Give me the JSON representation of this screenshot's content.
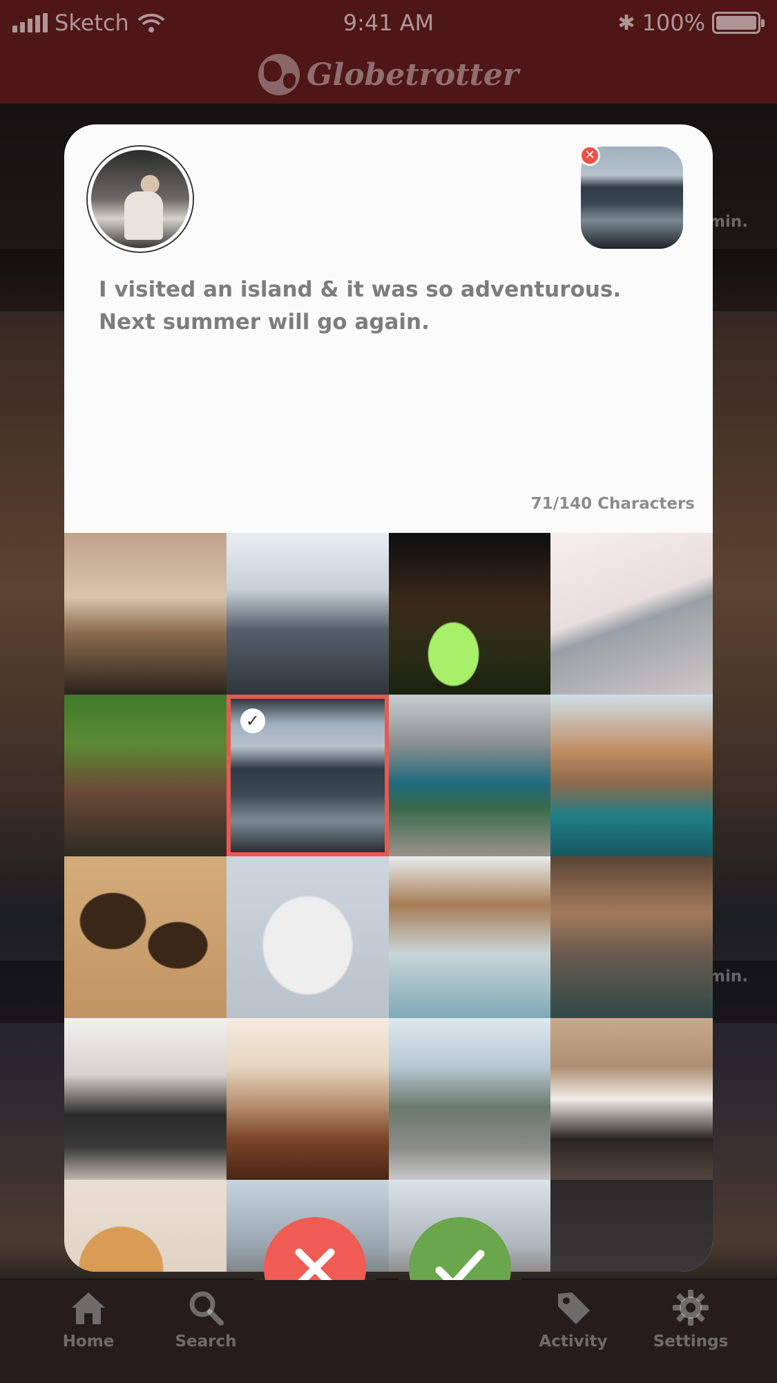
{
  "status_bar": {
    "carrier": "Sketch",
    "time": "9:41 AM",
    "battery": "100%"
  },
  "app": {
    "name": "Globetrotter"
  },
  "background_feed": {
    "time_labels": [
      "min.",
      "min."
    ]
  },
  "composer": {
    "text": "I visited an island & it was so adventurous. Next summer will go again.",
    "char_count": "71/140 Characters",
    "remove_icon": "close-icon"
  },
  "photos": [
    {
      "name": "photo-binoculars",
      "bg": "linear-gradient(180deg,#bfa48a 0%,#d9c3ab 40%,#8a6a4e 62%,#2c241f 100%)",
      "selected": false
    },
    {
      "name": "photo-airport",
      "bg": "linear-gradient(180deg,#e9eef2 0%,#c7d0d8 35%,#55606a 60%,#2e353c 100%)",
      "selected": false
    },
    {
      "name": "photo-tent",
      "bg": "radial-gradient(ellipse at 40% 75%,#a9f06a 0 18%,transparent 19%),linear-gradient(180deg,#0d0e10 0%,#3b2a1a 45%,#2a2c16 75%,#1a2210 100%)",
      "selected": false
    },
    {
      "name": "photo-wing",
      "bg": "linear-gradient(160deg,#f7eeee 0%,#e8dede 45%,#9aa0a6 55%,#cfc8c8 100%)",
      "selected": false
    },
    {
      "name": "photo-horse-rider",
      "bg": "linear-gradient(180deg,#3f7a2c 0%,#5b8a32 30%,#6a4a38 60%,#2d2a20 100%)",
      "selected": false
    },
    {
      "name": "photo-ferry-window",
      "bg": "linear-gradient(180deg,#1f262b 0%,#9fb0bf 18%,#b8c3cc 32%,#2f3a44 46%,#3b4955 62%,#7c8a95 78%,#1e2226 100%)",
      "selected": true
    },
    {
      "name": "photo-mountain-lake",
      "bg": "linear-gradient(180deg,#c7ced2 0%,#8d8f8f 30%,#1e6a7d 55%,#3a6b4c 70%,#9a928a 100%)",
      "selected": false
    },
    {
      "name": "photo-coastal-village",
      "bg": "linear-gradient(180deg,#cfe0e8 0%,#c08c62 35%,#8d6a4d 55%,#1f7f86 75%,#16585f 100%)",
      "selected": false
    },
    {
      "name": "photo-wooden-world-map",
      "bg": "radial-gradient(ellipse at 30% 40%,#3a2718 0 20%,transparent 21%),radial-gradient(ellipse at 70% 55%,#3a2718 0 18%,transparent 19%),linear-gradient(180deg,#d3ac7a 0%,#c29563 100%)",
      "selected": false
    },
    {
      "name": "photo-buddha-statue",
      "bg": "radial-gradient(ellipse at 50% 55%,#eeeeee 0 38%,transparent 40%),linear-gradient(180deg,#cdd6df 0%,#b9c2cb 100%)",
      "selected": false
    },
    {
      "name": "photo-surfer-pier",
      "bg": "linear-gradient(180deg,#e9edef 0%,#a67d55 30%,#c9d5d8 60%,#7fa9b6 100%)",
      "selected": false
    },
    {
      "name": "photo-cave-pool",
      "bg": "linear-gradient(180deg,#5b4536 0%,#a37a5c 35%,#6b5a4f 60%,#2f4a48 100%)",
      "selected": false
    },
    {
      "name": "photo-airport-seats",
      "bg": "linear-gradient(180deg,#f1f1f1 0%,#d5d3d0 35%,#2a2a2a 60%,#3b3b3b 80%,#bdb4a9 100%)",
      "selected": false
    },
    {
      "name": "photo-deck-sunset",
      "bg": "linear-gradient(180deg,#f4ebe0 0%,#e8d6c0 30%,#b48b6b 55%,#7a4428 75%,#4a2616 100%)",
      "selected": false
    },
    {
      "name": "photo-city-aerial",
      "bg": "linear-gradient(180deg,#dfe8ee 0%,#b7c8d3 30%,#6b7b6d 55%,#8a8a88 80%,#c9c9c9 100%)",
      "selected": false
    },
    {
      "name": "photo-woman-travel",
      "bg": "linear-gradient(180deg,#c9a98a 0%,#ad8f74 30%,#f0ece6 50%,#2a2420 75%,#534540 100%)",
      "selected": false
    },
    {
      "name": "photo-globe",
      "bg": "radial-gradient(circle at 35% 55%,#d89c55 0 30%,transparent 31%),linear-gradient(180deg,#eadfd3 0%,#d9cabb 100%)",
      "selected": false
    },
    {
      "name": "photo-mountains",
      "bg": "linear-gradient(180deg,#c8d4dd 0%,#9aa7b0 40%,#6b6e6a 70%,#3d3e3c 100%)",
      "selected": false
    },
    {
      "name": "photo-city-street",
      "bg": "linear-gradient(180deg,#d9e3e8 0%,#b0b8be 40%,#6d5f58 75%,#3d3532 100%)",
      "selected": false
    },
    {
      "name": "photo-hooded-traveler",
      "bg": "radial-gradient(ellipse at 55% 85%,#b8c8d8 0 22%,transparent 23%),linear-gradient(180deg,#2a2828 0%,#3a3838 60%,#1a1818 100%)",
      "selected": false
    }
  ],
  "actions": {
    "cancel_icon": "close-icon",
    "confirm_icon": "checkmark-icon"
  },
  "tabs": [
    {
      "label": "Home",
      "icon": "home-icon"
    },
    {
      "label": "Search",
      "icon": "search-icon"
    },
    {
      "label": "Activity",
      "icon": "tag-icon"
    },
    {
      "label": "Settings",
      "icon": "gear-icon"
    }
  ],
  "colors": {
    "header": "#4e1616",
    "accent_red": "#f05b53",
    "accent_green": "#6aa64c",
    "selection": "#e85a4f"
  }
}
